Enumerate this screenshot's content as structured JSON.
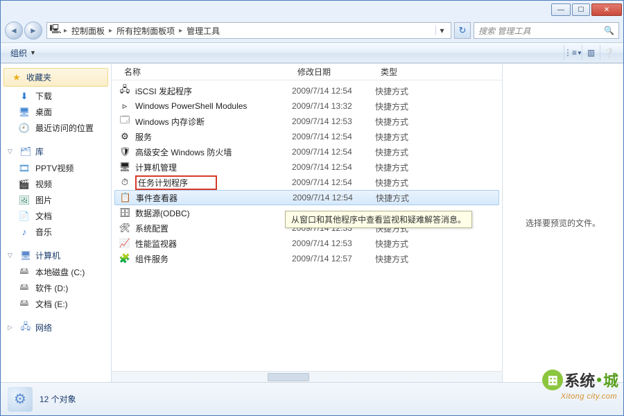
{
  "breadcrumb": {
    "root_icon": "computer",
    "items": [
      "控制面板",
      "所有控制面板项",
      "管理工具"
    ]
  },
  "search": {
    "placeholder": "搜索 管理工具"
  },
  "toolbar": {
    "organize": "组织"
  },
  "sidebar": {
    "favorites": {
      "label": "收藏夹",
      "items": [
        {
          "icon": "⬇",
          "label": "下载",
          "color": "#2a7ad4"
        },
        {
          "icon": "🖥",
          "label": "桌面",
          "color": "#4a8ad4"
        },
        {
          "icon": "🕘",
          "label": "最近访问的位置",
          "color": "#8a6a3a"
        }
      ]
    },
    "libraries": {
      "label": "库",
      "items": [
        {
          "icon": "🎞",
          "label": "PPTV视频",
          "color": "#3a8acc"
        },
        {
          "icon": "🎬",
          "label": "视频",
          "color": "#6a4a9a"
        },
        {
          "icon": "🖼",
          "label": "图片",
          "color": "#3a8a6a"
        },
        {
          "icon": "📄",
          "label": "文档",
          "color": "#6a8aaa"
        },
        {
          "icon": "♪",
          "label": "音乐",
          "color": "#3a7ad4"
        }
      ]
    },
    "computer": {
      "label": "计算机",
      "items": [
        {
          "icon": "🖴",
          "label": "本地磁盘 (C:)",
          "color": "#888"
        },
        {
          "icon": "🖴",
          "label": "软件 (D:)",
          "color": "#888"
        },
        {
          "icon": "🖴",
          "label": "文档 (E:)",
          "color": "#888"
        }
      ]
    },
    "network": {
      "label": "网络"
    }
  },
  "columns": {
    "name": "名称",
    "date": "修改日期",
    "type": "类型"
  },
  "files": [
    {
      "icon": "🖧",
      "name": "iSCSI 发起程序",
      "date": "2009/7/14 12:54",
      "type": "快捷方式"
    },
    {
      "icon": "▹",
      "name": "Windows PowerShell Modules",
      "date": "2009/7/14 13:32",
      "type": "快捷方式"
    },
    {
      "icon": "🗔",
      "name": "Windows 内存诊断",
      "date": "2009/7/14 12:53",
      "type": "快捷方式"
    },
    {
      "icon": "⚙",
      "name": "服务",
      "date": "2009/7/14 12:54",
      "type": "快捷方式"
    },
    {
      "icon": "🛡",
      "name": "高级安全 Windows 防火墙",
      "date": "2009/7/14 12:54",
      "type": "快捷方式"
    },
    {
      "icon": "🖥",
      "name": "计算机管理",
      "date": "2009/7/14 12:54",
      "type": "快捷方式"
    },
    {
      "icon": "⏱",
      "name": "任务计划程序",
      "date": "2009/7/14 12:54",
      "type": "快捷方式",
      "boxed": true
    },
    {
      "icon": "📋",
      "name": "事件查看器",
      "date": "2009/7/14 12:54",
      "type": "快捷方式",
      "selected": true
    },
    {
      "icon": "🗄",
      "name": "数据源(ODBC)",
      "date": "",
      "type": ""
    },
    {
      "icon": "🛠",
      "name": "系统配置",
      "date": "2009/7/14 12:53",
      "type": "快捷方式"
    },
    {
      "icon": "📈",
      "name": "性能监视器",
      "date": "2009/7/14 12:53",
      "type": "快捷方式"
    },
    {
      "icon": "🧩",
      "name": "组件服务",
      "date": "2009/7/14 12:57",
      "type": "快捷方式"
    }
  ],
  "tooltip": "从窗口和其他程序中查看监视和疑难解答消息。",
  "preview": {
    "empty": "选择要预览的文件。"
  },
  "status": {
    "count_label": "12 个对象"
  },
  "watermark": {
    "brand1": "系统",
    "dot": "•",
    "brand2": "城",
    "sub": "Xitong city.com"
  }
}
